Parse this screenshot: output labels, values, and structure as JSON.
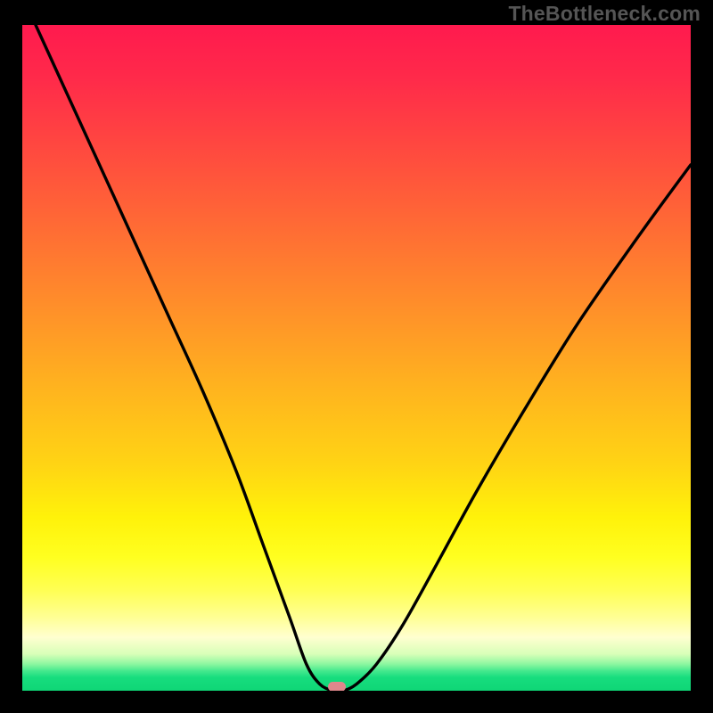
{
  "watermark": "TheBottleneck.com",
  "colors": {
    "frame": "#000000",
    "gradient_top": "#ff1a4e",
    "gradient_mid": "#ffd414",
    "gradient_bottom": "#0fd676",
    "curve": "#000000",
    "marker": "#e0878c"
  },
  "chart_data": {
    "type": "line",
    "title": "",
    "xlabel": "",
    "ylabel": "",
    "xlim": [
      0,
      100
    ],
    "ylim": [
      0,
      100
    ],
    "series": [
      {
        "name": "bottleneck-curve",
        "x": [
          2,
          7,
          12,
          17,
          22,
          27,
          32,
          36,
          40,
          42.5,
          44.5,
          46.5,
          48,
          50,
          53,
          57,
          62,
          68,
          75,
          83,
          92,
          100
        ],
        "y": [
          100,
          89,
          78,
          67,
          56,
          45,
          33,
          22,
          11,
          4,
          1,
          0,
          0,
          1,
          4,
          10,
          19,
          30,
          42,
          55,
          68,
          79
        ]
      }
    ],
    "minimum_marker": {
      "x": 47,
      "y": 0
    }
  }
}
